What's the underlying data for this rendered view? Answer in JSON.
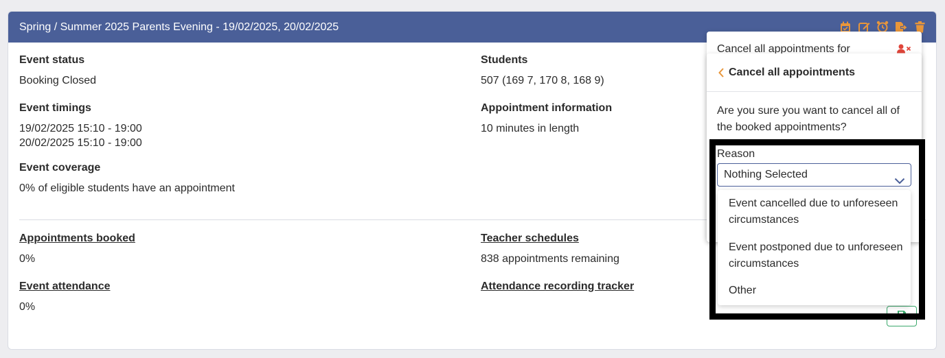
{
  "header": {
    "title": "Spring / Summer 2025 Parents Evening - 19/02/2025, 20/02/2025",
    "icons": [
      "calendar-icon",
      "edit-icon",
      "alarm-icon",
      "export-icon",
      "trash-icon"
    ],
    "icon_color": "#e8963a",
    "background": "#4a5f98"
  },
  "left": {
    "event_status": {
      "label": "Event status",
      "value": "Booking Closed"
    },
    "event_timings": {
      "label": "Event timings",
      "lines": [
        "19/02/2025 15:10 - 19:00",
        "20/02/2025 15:10 - 19:00"
      ]
    },
    "event_coverage": {
      "label": "Event coverage",
      "value": "0% of eligible students have an appointment"
    },
    "appointments_booked": {
      "label": "Appointments booked",
      "value": "0%"
    },
    "event_attendance": {
      "label": "Event attendance",
      "value": "0%"
    }
  },
  "middle": {
    "students": {
      "label": "Students",
      "value": "507 (169 7, 170 8, 168 9)"
    },
    "appointment_information": {
      "label": "Appointment information",
      "value": "10 minutes in length"
    },
    "teacher_schedules": {
      "label": "Teacher schedules",
      "value": "838 appointments remaining"
    },
    "attendance_tracker": {
      "label": "Attendance recording tracker"
    }
  },
  "popover_back": {
    "text": "Cancel all appointments for",
    "icon": "remove-user-icon"
  },
  "popover": {
    "title": "Cancel all appointments",
    "question": "Are you sure you want to cancel all of the booked appointments?",
    "reason": {
      "label": "Reason",
      "selected": "Nothing Selected",
      "options": [
        "Event cancelled due to unforeseen circumstances",
        "Event postponed due to unforeseen circumstances",
        "Other"
      ]
    }
  },
  "save_button": {
    "icon": "save-icon",
    "color": "#3aa86b"
  }
}
